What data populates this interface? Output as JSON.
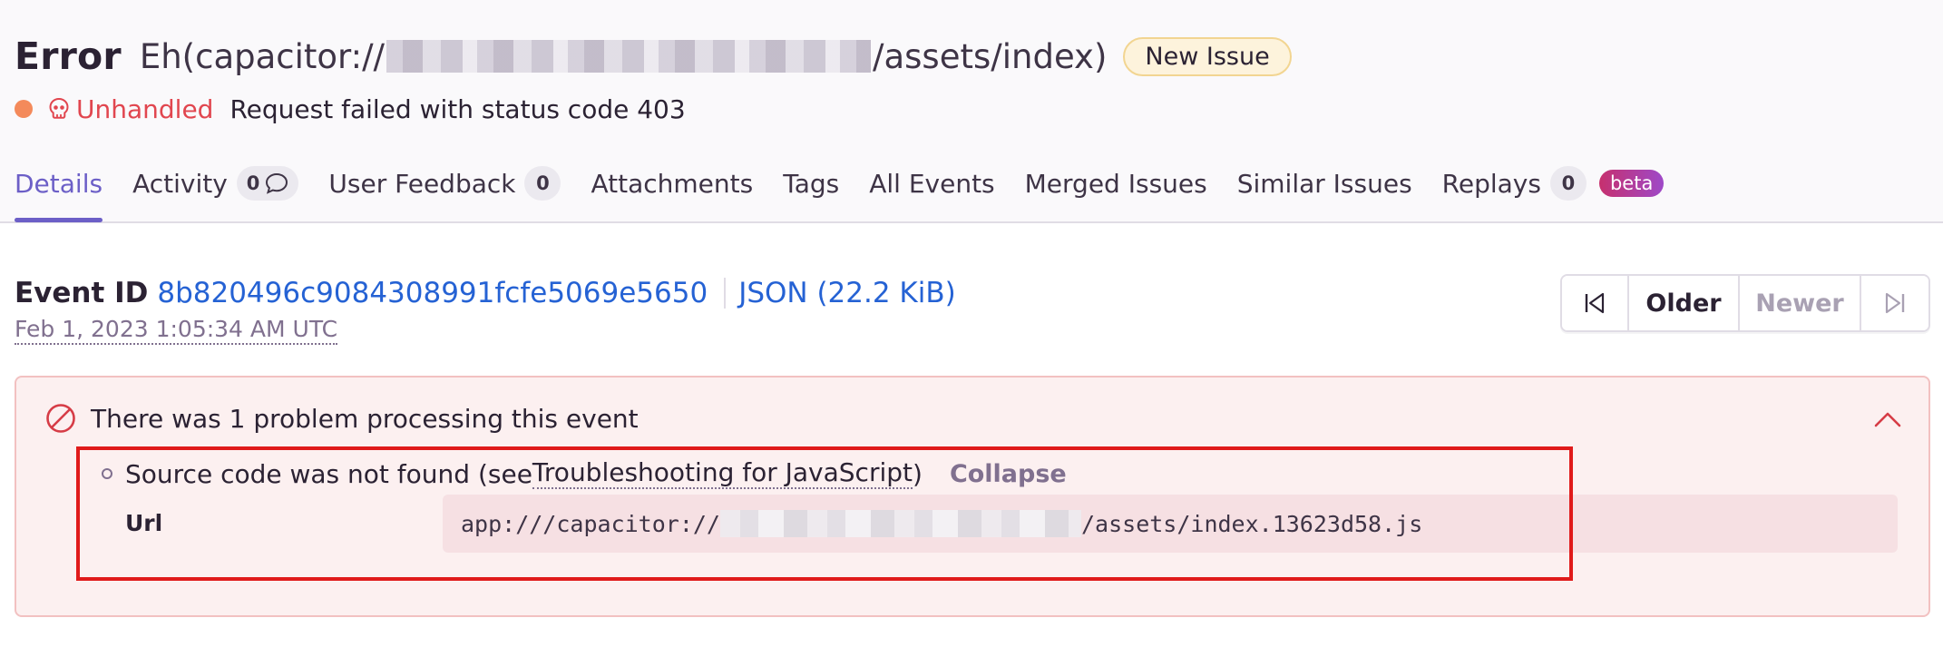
{
  "header": {
    "issue_type": "Error",
    "issue_value_prefix": "Eh(capacitor://",
    "issue_value_suffix": "/assets/index)",
    "new_issue_badge": "New Issue",
    "unhandled_label": "Unhandled",
    "error_message": "Request failed with status code 403",
    "colors": {
      "accent": "#6c5fc7",
      "unhandled": "#e1464f",
      "status_dot": "#f48a5b"
    }
  },
  "tabs": [
    {
      "label": "Details",
      "active": true
    },
    {
      "label": "Activity",
      "count": "0"
    },
    {
      "label": "User Feedback",
      "count": "0"
    },
    {
      "label": "Attachments"
    },
    {
      "label": "Tags"
    },
    {
      "label": "All Events"
    },
    {
      "label": "Merged Issues"
    },
    {
      "label": "Similar Issues"
    },
    {
      "label": "Replays",
      "count": "0",
      "badge": "beta"
    }
  ],
  "event": {
    "label": "Event ID",
    "id": "8b820496c9084308991fcfe5069e5650",
    "json_link": "JSON (22.2 KiB)",
    "date": "Feb 1, 2023 1:05:34 AM UTC"
  },
  "pager": {
    "older": "Older",
    "newer": "Newer"
  },
  "problems": {
    "heading": "There was 1 problem processing this event",
    "item_text_prefix": "Source code was not found (see ",
    "item_link": "Troubleshooting for JavaScript",
    "item_text_suffix": ")",
    "collapse": "Collapse",
    "url_label": "Url",
    "url_prefix": "app:///capacitor://",
    "url_suffix": "/assets/index.13623d58.js"
  }
}
